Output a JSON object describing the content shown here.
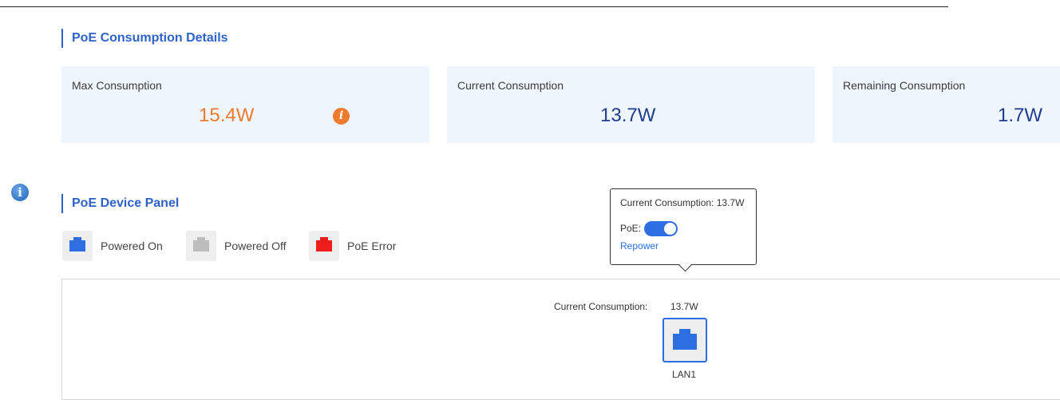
{
  "consumption_details": {
    "title": "PoE Consumption Details",
    "max": {
      "label": "Max Consumption",
      "value": "15.4W",
      "icon": "info-warning-icon"
    },
    "current": {
      "label": "Current Consumption",
      "value": "13.7W"
    },
    "remaining": {
      "label": "Remaining Consumption",
      "value": "1.7W"
    }
  },
  "device_panel": {
    "title": "PoE Device Panel",
    "legend": [
      {
        "label": "Powered On",
        "color": "#2d6fe3"
      },
      {
        "label": "Powered Off",
        "color": "#bcbcbc"
      },
      {
        "label": "PoE Error",
        "color": "#f01d1d"
      }
    ],
    "tooltip": {
      "consumption": "Current Consumption: 13.7W",
      "poe_label": "PoE:",
      "poe_enabled": true,
      "repower": "Repower"
    },
    "port": {
      "consumption_label": "Current Consumption:",
      "consumption_value": "13.7W",
      "name": "LAN1",
      "status": "Powered On"
    }
  },
  "colors": {
    "accent": "#2f62c9",
    "warning": "#ef7b2e",
    "value": "#1f3d8c"
  }
}
